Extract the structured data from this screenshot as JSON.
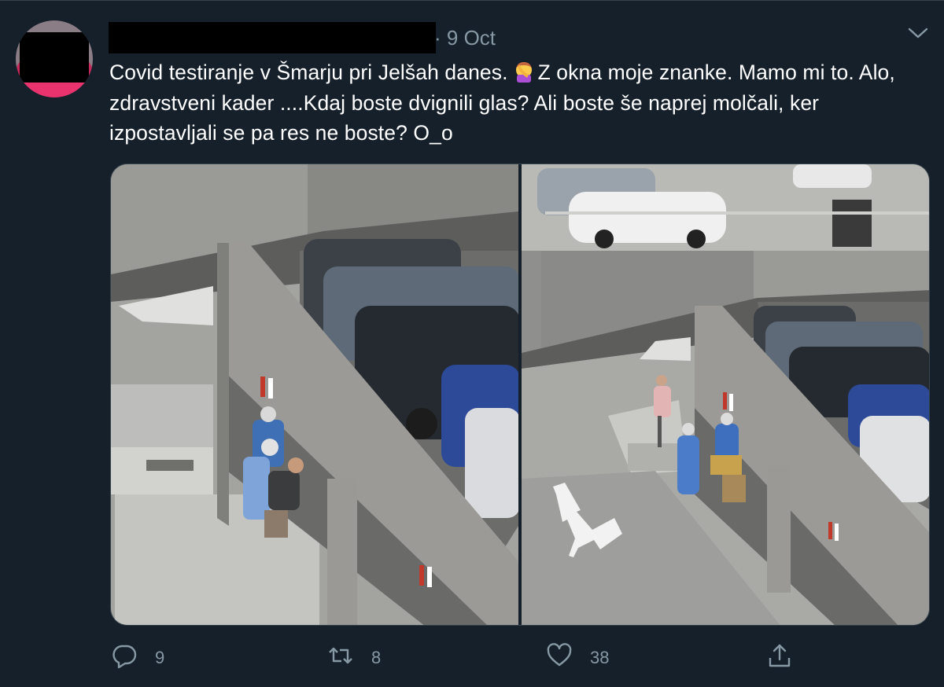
{
  "tweet": {
    "date": "· 9 Oct",
    "text_line1": "Covid testiranje v Šmarju pri Jelšah danes.",
    "text_rest": "Z okna moje znanke. Mamo mi to. Alo, zdravstveni kader ....Kdaj boste dvignili glas? Ali boste še naprej molčali, ker izpostavljali se pa res ne boste? O_o",
    "emoji": "facepalm-emoji"
  },
  "actions": {
    "replies": "9",
    "retweets": "8",
    "likes": "38"
  },
  "icons": {
    "reply": "reply-icon",
    "retweet": "retweet-icon",
    "like": "heart-icon",
    "share": "share-icon",
    "more": "chevron-down-icon"
  },
  "colors": {
    "background": "#15202b",
    "text": "#ffffff",
    "secondary": "#8899a6",
    "border": "#38444d"
  }
}
